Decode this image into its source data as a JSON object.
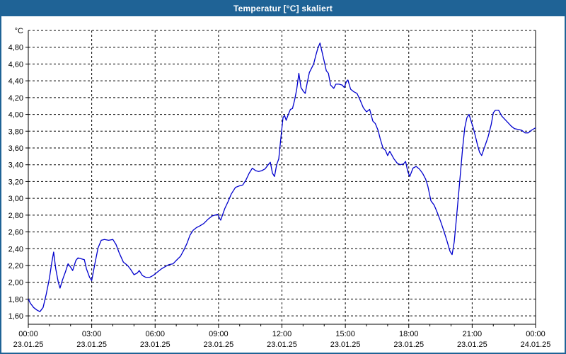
{
  "window": {
    "title": "Temperatur [°C] skaliert"
  },
  "colors": {
    "titlebar": "#1f6396",
    "window_border": "#1f6396",
    "title_text": "#ffffff",
    "plot_background": "#ffffff",
    "grid": "#000000",
    "axis": "#000000",
    "label_text": "#000000",
    "line": "#0000cd"
  },
  "chart_data": {
    "type": "line",
    "title": "Temperatur [°C] skaliert",
    "unit_label": "°C",
    "grid": "dashed",
    "legend": "none",
    "x_axis": {
      "range_hours": [
        0,
        24
      ],
      "minor_tick_every_hours": 1,
      "major_tick_every_hours": 3,
      "tick_labels": [
        {
          "hour": 0,
          "time": "00:00",
          "date": "23.01.25"
        },
        {
          "hour": 3,
          "time": "03:00",
          "date": "23.01.25"
        },
        {
          "hour": 6,
          "time": "06:00",
          "date": "23.01.25"
        },
        {
          "hour": 9,
          "time": "09:00",
          "date": "23.01.25"
        },
        {
          "hour": 12,
          "time": "12:00",
          "date": "23.01.25"
        },
        {
          "hour": 15,
          "time": "15:00",
          "date": "23.01.25"
        },
        {
          "hour": 18,
          "time": "18:00",
          "date": "23.01.25"
        },
        {
          "hour": 21,
          "time": "21:00",
          "date": "23.01.25"
        },
        {
          "hour": 24,
          "time": "00:00",
          "date": "24.01.25"
        }
      ]
    },
    "y_axis": {
      "ylim": [
        1.5,
        5.0
      ],
      "tick_values": [
        1.6,
        1.8,
        2.0,
        2.2,
        2.4,
        2.6,
        2.8,
        3.0,
        3.2,
        3.4,
        3.6,
        3.8,
        4.0,
        4.2,
        4.4,
        4.6,
        4.8
      ],
      "tick_labels": [
        "1,60",
        "1,80",
        "2,00",
        "2,20",
        "2,40",
        "2,60",
        "2,80",
        "3,00",
        "3,20",
        "3,40",
        "3,60",
        "3,80",
        "4,00",
        "4,20",
        "4,40",
        "4,60",
        "4,80"
      ]
    },
    "series": [
      {
        "name": "Temperatur",
        "color": "#0000cd",
        "points": [
          [
            0.0,
            1.8
          ],
          [
            0.1,
            1.75
          ],
          [
            0.25,
            1.7
          ],
          [
            0.4,
            1.67
          ],
          [
            0.55,
            1.65
          ],
          [
            0.7,
            1.7
          ],
          [
            0.85,
            1.86
          ],
          [
            1.0,
            2.05
          ],
          [
            1.1,
            2.22
          ],
          [
            1.2,
            2.36
          ],
          [
            1.3,
            2.16
          ],
          [
            1.42,
            2.0
          ],
          [
            1.5,
            1.93
          ],
          [
            1.62,
            2.03
          ],
          [
            1.75,
            2.12
          ],
          [
            1.88,
            2.22
          ],
          [
            2.0,
            2.18
          ],
          [
            2.1,
            2.14
          ],
          [
            2.25,
            2.26
          ],
          [
            2.35,
            2.29
          ],
          [
            2.5,
            2.28
          ],
          [
            2.65,
            2.27
          ],
          [
            2.75,
            2.16
          ],
          [
            2.9,
            2.06
          ],
          [
            3.0,
            2.02
          ],
          [
            3.15,
            2.22
          ],
          [
            3.3,
            2.41
          ],
          [
            3.45,
            2.5
          ],
          [
            3.6,
            2.51
          ],
          [
            3.8,
            2.5
          ],
          [
            4.0,
            2.51
          ],
          [
            4.15,
            2.45
          ],
          [
            4.3,
            2.35
          ],
          [
            4.5,
            2.24
          ],
          [
            4.7,
            2.2
          ],
          [
            4.85,
            2.15
          ],
          [
            5.0,
            2.09
          ],
          [
            5.15,
            2.11
          ],
          [
            5.25,
            2.14
          ],
          [
            5.4,
            2.08
          ],
          [
            5.55,
            2.06
          ],
          [
            5.75,
            2.06
          ],
          [
            5.9,
            2.08
          ],
          [
            6.1,
            2.12
          ],
          [
            6.3,
            2.16
          ],
          [
            6.5,
            2.19
          ],
          [
            6.65,
            2.21
          ],
          [
            6.85,
            2.22
          ],
          [
            7.0,
            2.26
          ],
          [
            7.2,
            2.31
          ],
          [
            7.35,
            2.38
          ],
          [
            7.5,
            2.46
          ],
          [
            7.65,
            2.56
          ],
          [
            7.8,
            2.62
          ],
          [
            7.95,
            2.65
          ],
          [
            8.1,
            2.67
          ],
          [
            8.3,
            2.7
          ],
          [
            8.5,
            2.75
          ],
          [
            8.7,
            2.79
          ],
          [
            8.95,
            2.81
          ],
          [
            9.1,
            2.74
          ],
          [
            9.3,
            2.88
          ],
          [
            9.45,
            2.96
          ],
          [
            9.6,
            3.05
          ],
          [
            9.8,
            3.13
          ],
          [
            10.0,
            3.15
          ],
          [
            10.15,
            3.16
          ],
          [
            10.3,
            3.22
          ],
          [
            10.45,
            3.3
          ],
          [
            10.6,
            3.36
          ],
          [
            10.75,
            3.33
          ],
          [
            10.9,
            3.32
          ],
          [
            11.05,
            3.33
          ],
          [
            11.2,
            3.35
          ],
          [
            11.35,
            3.4
          ],
          [
            11.45,
            3.43
          ],
          [
            11.55,
            3.3
          ],
          [
            11.65,
            3.26
          ],
          [
            11.75,
            3.4
          ],
          [
            11.85,
            3.47
          ],
          [
            11.95,
            3.72
          ],
          [
            12.05,
            3.96
          ],
          [
            12.12,
            3.99
          ],
          [
            12.2,
            3.93
          ],
          [
            12.3,
            4.0
          ],
          [
            12.4,
            4.06
          ],
          [
            12.5,
            4.07
          ],
          [
            12.6,
            4.17
          ],
          [
            12.7,
            4.3
          ],
          [
            12.8,
            4.49
          ],
          [
            12.9,
            4.32
          ],
          [
            13.0,
            4.28
          ],
          [
            13.1,
            4.25
          ],
          [
            13.2,
            4.38
          ],
          [
            13.3,
            4.5
          ],
          [
            13.4,
            4.55
          ],
          [
            13.5,
            4.6
          ],
          [
            13.6,
            4.7
          ],
          [
            13.7,
            4.79
          ],
          [
            13.8,
            4.85
          ],
          [
            13.9,
            4.74
          ],
          [
            14.0,
            4.63
          ],
          [
            14.1,
            4.52
          ],
          [
            14.2,
            4.49
          ],
          [
            14.3,
            4.35
          ],
          [
            14.45,
            4.31
          ],
          [
            14.55,
            4.36
          ],
          [
            14.7,
            4.36
          ],
          [
            14.85,
            4.35
          ],
          [
            14.95,
            4.32
          ],
          [
            15.05,
            4.39
          ],
          [
            15.12,
            4.41
          ],
          [
            15.25,
            4.3
          ],
          [
            15.4,
            4.27
          ],
          [
            15.55,
            4.25
          ],
          [
            15.7,
            4.17
          ],
          [
            15.85,
            4.08
          ],
          [
            16.0,
            4.03
          ],
          [
            16.15,
            4.06
          ],
          [
            16.3,
            3.92
          ],
          [
            16.42,
            3.89
          ],
          [
            16.55,
            3.81
          ],
          [
            16.65,
            3.71
          ],
          [
            16.78,
            3.6
          ],
          [
            16.9,
            3.57
          ],
          [
            17.0,
            3.51
          ],
          [
            17.1,
            3.56
          ],
          [
            17.3,
            3.47
          ],
          [
            17.45,
            3.42
          ],
          [
            17.6,
            3.4
          ],
          [
            17.75,
            3.41
          ],
          [
            17.85,
            3.44
          ],
          [
            17.95,
            3.32
          ],
          [
            18.05,
            3.26
          ],
          [
            18.2,
            3.36
          ],
          [
            18.35,
            3.38
          ],
          [
            18.5,
            3.35
          ],
          [
            18.65,
            3.3
          ],
          [
            18.8,
            3.23
          ],
          [
            18.9,
            3.15
          ],
          [
            19.05,
            2.97
          ],
          [
            19.2,
            2.92
          ],
          [
            19.35,
            2.83
          ],
          [
            19.5,
            2.73
          ],
          [
            19.65,
            2.62
          ],
          [
            19.8,
            2.5
          ],
          [
            19.95,
            2.37
          ],
          [
            20.05,
            2.33
          ],
          [
            20.15,
            2.48
          ],
          [
            20.25,
            2.75
          ],
          [
            20.35,
            3.03
          ],
          [
            20.45,
            3.31
          ],
          [
            20.55,
            3.6
          ],
          [
            20.65,
            3.84
          ],
          [
            20.75,
            3.96
          ],
          [
            20.85,
            4.0
          ],
          [
            20.95,
            3.92
          ],
          [
            21.05,
            3.84
          ],
          [
            21.15,
            3.74
          ],
          [
            21.25,
            3.64
          ],
          [
            21.35,
            3.55
          ],
          [
            21.45,
            3.51
          ],
          [
            21.6,
            3.62
          ],
          [
            21.75,
            3.73
          ],
          [
            21.9,
            3.88
          ],
          [
            22.0,
            4.02
          ],
          [
            22.1,
            4.05
          ],
          [
            22.25,
            4.05
          ],
          [
            22.4,
            3.98
          ],
          [
            22.55,
            3.94
          ],
          [
            22.7,
            3.9
          ],
          [
            22.85,
            3.86
          ],
          [
            23.0,
            3.83
          ],
          [
            23.2,
            3.82
          ],
          [
            23.35,
            3.81
          ],
          [
            23.5,
            3.78
          ],
          [
            23.65,
            3.78
          ],
          [
            23.8,
            3.81
          ],
          [
            24.0,
            3.84
          ]
        ]
      }
    ]
  }
}
